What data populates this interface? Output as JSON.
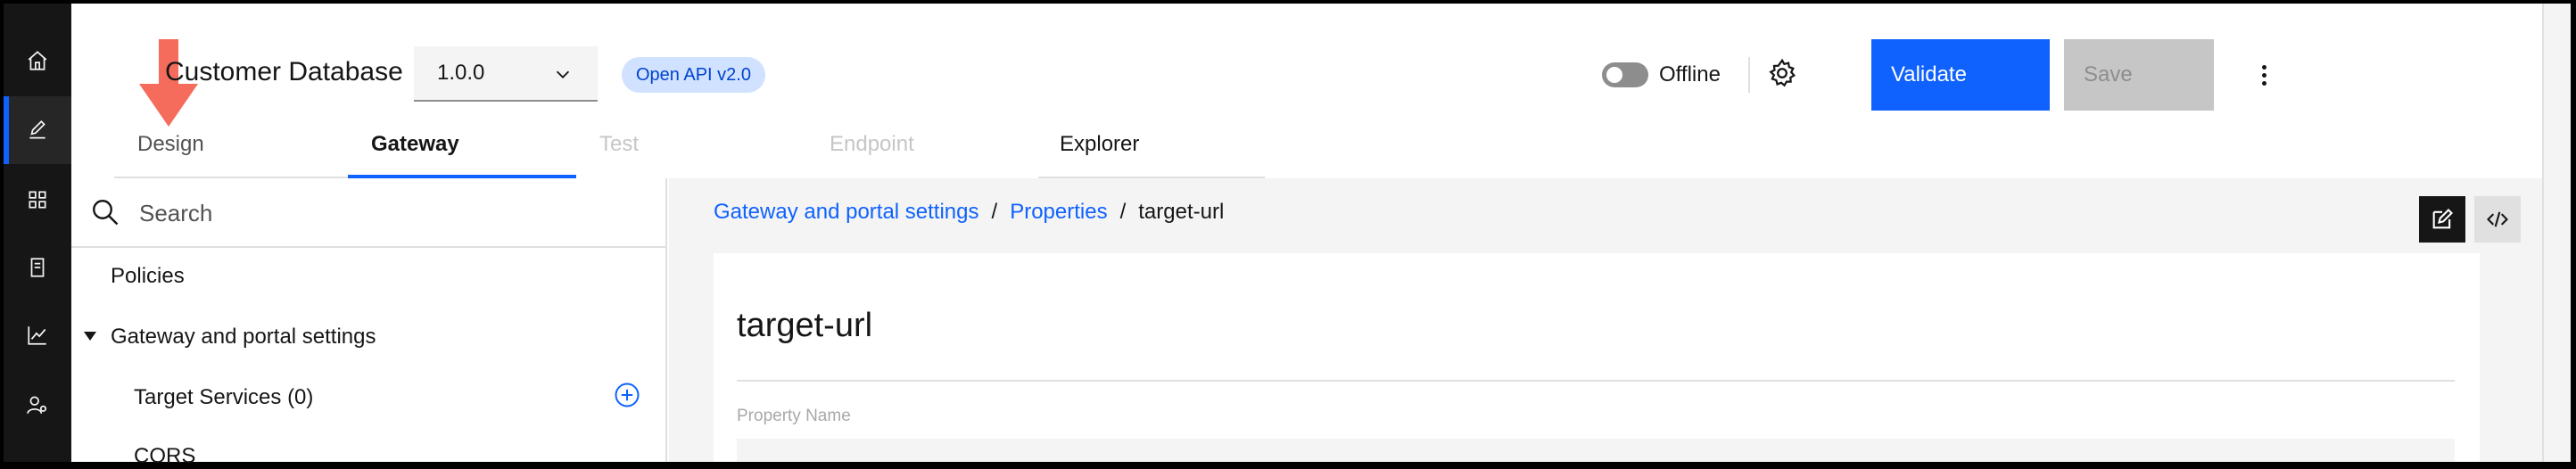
{
  "app": {
    "title": "Customer Database",
    "version": "1.0.0",
    "api_tag": "Open API v2.0"
  },
  "toolbar": {
    "offline_label": "Offline",
    "validate_label": "Validate",
    "save_label": "Save"
  },
  "tabs": [
    {
      "label": "Design",
      "state": "normal"
    },
    {
      "label": "Gateway",
      "state": "selected"
    },
    {
      "label": "Test",
      "state": "disabled"
    },
    {
      "label": "Endpoint",
      "state": "disabled"
    },
    {
      "label": "Explorer",
      "state": "normal"
    }
  ],
  "left_panel": {
    "search_placeholder": "Search",
    "items": [
      {
        "label": "Policies"
      },
      {
        "label": "Gateway and portal settings"
      },
      {
        "label": "Target Services (0)"
      },
      {
        "label": "CORS"
      }
    ]
  },
  "breadcrumb": {
    "items": [
      "Gateway and portal settings",
      "Properties"
    ],
    "separator": "/",
    "current": "target-url"
  },
  "content": {
    "title": "target-url",
    "property_label": "Property Name"
  },
  "rail": {
    "icons": [
      "home-icon",
      "edit-icon",
      "apps-icon",
      "catalog-icon",
      "analytics-icon",
      "user-admin-icon"
    ]
  },
  "colors": {
    "primary": "#0f62fe",
    "rail_bg": "#161616",
    "tag_bg": "#d0e2ff",
    "arrow": "#f56c5c"
  }
}
